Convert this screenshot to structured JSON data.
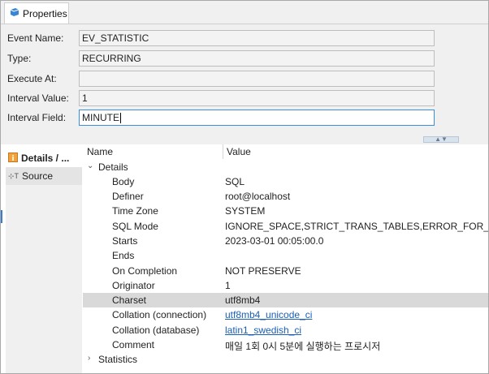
{
  "tab": {
    "label": "Properties",
    "icon": "properties-icon"
  },
  "form": {
    "event_name": {
      "label": "Event Name:",
      "value": "EV_STATISTIC"
    },
    "type": {
      "label": "Type:",
      "value": "RECURRING"
    },
    "execute_at": {
      "label": "Execute At:",
      "value": ""
    },
    "interval_value": {
      "label": "Interval Value:",
      "value": "1"
    },
    "interval_field": {
      "label": "Interval Field:",
      "value": "MINUTE"
    }
  },
  "side": {
    "items": [
      {
        "label": "Details / ...",
        "icon": "info-icon"
      },
      {
        "label": "Source",
        "icon": "source-icon"
      }
    ]
  },
  "grid": {
    "headers": {
      "name": "Name",
      "value": "Value"
    },
    "details_label": "Details",
    "rows": [
      {
        "name": "Body",
        "value": "SQL"
      },
      {
        "name": "Definer",
        "value": "root@localhost"
      },
      {
        "name": "Time Zone",
        "value": "SYSTEM"
      },
      {
        "name": "SQL Mode",
        "value": "IGNORE_SPACE,STRICT_TRANS_TABLES,ERROR_FOR_DIVISIO"
      },
      {
        "name": "Starts",
        "value": "2023-03-01 00:05:00.0"
      },
      {
        "name": "Ends",
        "value": ""
      },
      {
        "name": "On Completion",
        "value": "NOT PRESERVE"
      },
      {
        "name": "Originator",
        "value": "1"
      },
      {
        "name": "Charset",
        "value": "utf8mb4"
      },
      {
        "name": "Collation (connection)",
        "value": "utf8mb4_unicode_ci"
      },
      {
        "name": "Collation (database)",
        "value": "latin1_swedish_ci"
      },
      {
        "name": "Comment",
        "value": "매일 1회 0시 5분에 실행하는 프로시저"
      }
    ],
    "statistics_label": "Statistics"
  },
  "colors": {
    "accent": "#3c8dde",
    "link": "#1a5fb4",
    "selection": "#d9d9d9"
  }
}
